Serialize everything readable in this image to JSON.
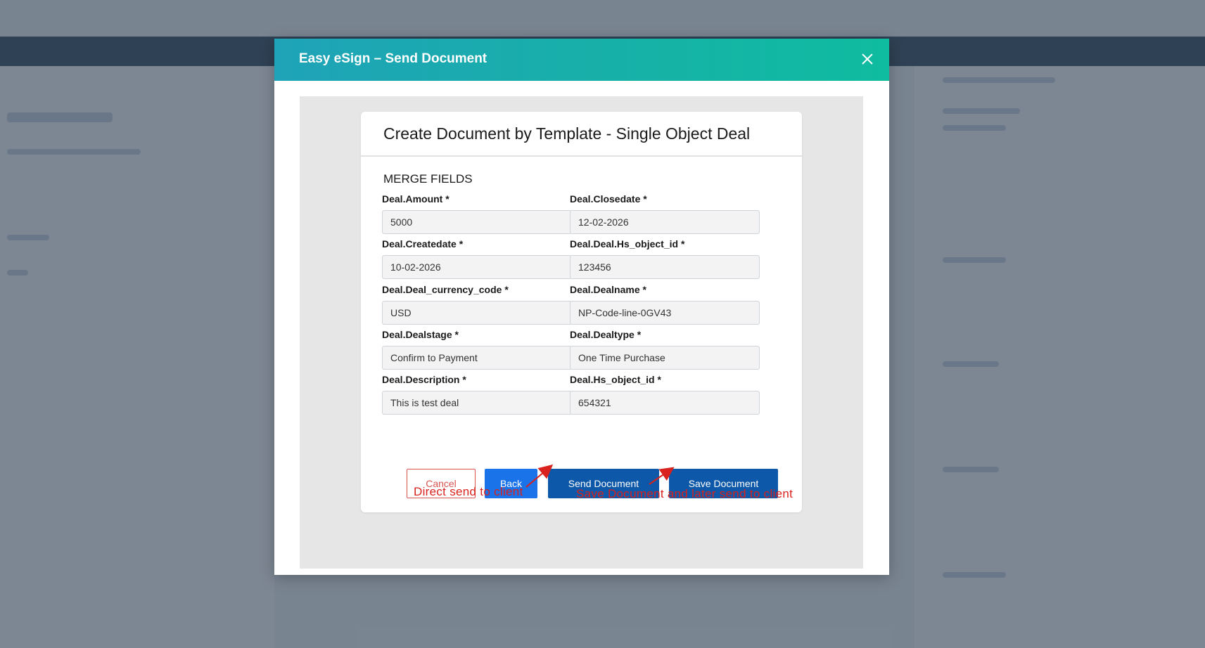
{
  "modal": {
    "title": "Easy eSign – Send Document",
    "close_label": "×"
  },
  "card": {
    "title": "Create Document by Template - Single Object Deal",
    "section_title": "MERGE FIELDS"
  },
  "fields": [
    {
      "label": "Deal.Amount *",
      "value": "5000"
    },
    {
      "label": "Deal.Closedate *",
      "value": "12-02-2026"
    },
    {
      "label": "Deal.Createdate *",
      "value": "10-02-2026"
    },
    {
      "label": "Deal.Deal.Hs_object_id *",
      "value": "123456"
    },
    {
      "label": "Deal.Deal_currency_code *",
      "value": "USD"
    },
    {
      "label": "Deal.Dealname *",
      "value": "NP-Code-line-0GV43"
    },
    {
      "label": "Deal.Dealstage *",
      "value": "Confirm to Payment"
    },
    {
      "label": "Deal.Dealtype *",
      "value": "One Time Purchase"
    },
    {
      "label": "Deal.Description *",
      "value": "This is test deal"
    },
    {
      "label": "Deal.Hs_object_id *",
      "value": "654321"
    }
  ],
  "buttons": {
    "cancel": "Cancel",
    "back": "Back",
    "send": "Send Document",
    "save": "Save Document"
  },
  "annotations": {
    "send_note": "Direct send to client",
    "save_note": "Save Document and later send to client"
  },
  "colors": {
    "header_gradient_start": "#1fa3b8",
    "header_gradient_end": "#0fbca0",
    "primary_button": "#0d58a8",
    "back_button": "#1a73e8",
    "cancel": "#d9534f",
    "annotation": "#d9211d"
  }
}
